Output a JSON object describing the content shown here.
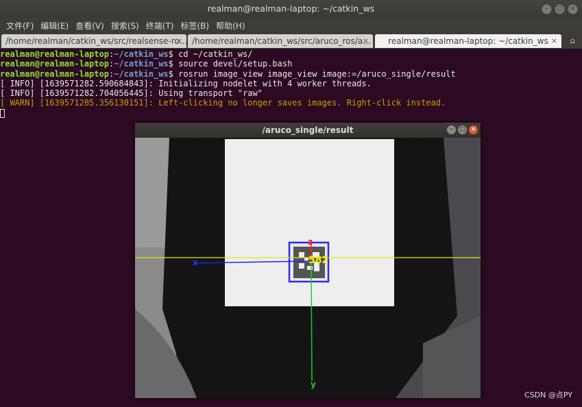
{
  "window": {
    "title": "realman@realman-laptop: ~/catkin_ws"
  },
  "menu": [
    "文件(F)",
    "编辑(E)",
    "查看(V)",
    "搜索(S)",
    "终端(T)",
    "标签(B)",
    "帮助(H)"
  ],
  "tabs": [
    {
      "label": "/home/realman/catkin_ws/src/realsense-ro...",
      "close": "×"
    },
    {
      "label": "/home/realman/catkin_ws/src/aruco_ros/a...",
      "close": "×"
    },
    {
      "label": "realman@realman-laptop: ~/catkin_ws",
      "close": "×"
    }
  ],
  "terminal": {
    "prompt_user": "realman@realman-laptop",
    "prompt_path": "~/catkin_ws",
    "commands": [
      "cd ~/catkin_ws/",
      "source devel/setup.bash",
      "rosrun image_view image_view image:=/aruco_single/result"
    ],
    "info1": "[ INFO] [1639571282.590684843]: Initializing nodelet with 4 worker threads.",
    "info2": "[ INFO] [1639571282.704056445]: Using transport \"raw\"",
    "warn": "[ WARN] [1639571285.356130151]: Left-clicking no longer saves images. Right-click instead."
  },
  "image_window": {
    "title": "/aruco_single/result",
    "marker_id": "582",
    "axis_z": "z",
    "axis_x": "x",
    "axis_y": "y",
    "colors": {
      "x_axis": "#2222ff",
      "y_axis": "#22cc22",
      "z_axis": "#ff2020",
      "marker_box": "#2a2aff",
      "marker_label": "#ffee00",
      "hline": "#e6e600"
    }
  },
  "watermark": "CSDN @点PY"
}
